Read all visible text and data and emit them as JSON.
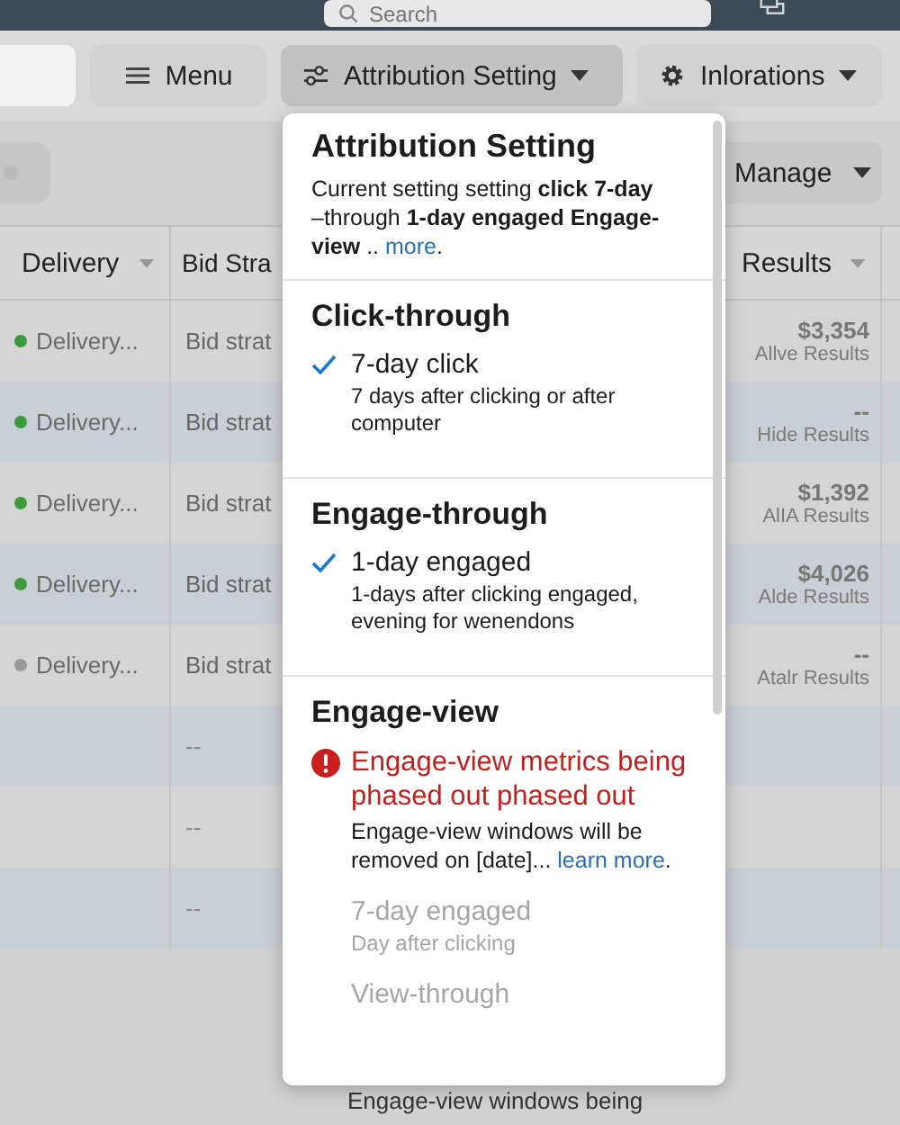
{
  "topbar": {
    "search": {
      "placeholder": "Search"
    }
  },
  "toolbar": {
    "buttons": [
      {
        "label": "Menu",
        "kind": "menu",
        "selected": false
      },
      {
        "label": "Attribution Setting",
        "kind": "filter",
        "selected": true
      },
      {
        "label": "Inlorations",
        "kind": "settings",
        "selected": false
      }
    ]
  },
  "toggle": {
    "on": false
  },
  "manage_button": "Manage",
  "table": {
    "columns": [
      "Delivery",
      "Bid Stra",
      "Results"
    ],
    "rows": [
      {
        "delivery": "Delivery...",
        "color": "#3d9b3d",
        "bid": "Bid strat",
        "result": "$3,354",
        "result_note": "Allve Results"
      },
      {
        "delivery": "Delivery...",
        "color": "#3d9b3d",
        "bid": "Bid strat",
        "result": "--",
        "result_note": "Hide Results"
      },
      {
        "delivery": "Delivery...",
        "color": "#3d9b3d",
        "bid": "Bid strat",
        "result": "$1,392",
        "result_note": "AlIA Results"
      },
      {
        "delivery": "Delivery...",
        "color": "#3d9b3d",
        "bid": "Bid strat",
        "result": "$4,026",
        "result_note": "Alde Results"
      },
      {
        "delivery": "Delivery...",
        "color": "#9a9a9a",
        "bid": "Bid strat",
        "result": "--",
        "result_note": "Atalr Results"
      },
      {
        "bid": "--"
      },
      {
        "bid": "--"
      },
      {
        "bid": "--"
      }
    ],
    "note": "Engage-view windows being"
  },
  "popover": {
    "title": "Attribution Setting",
    "summary": "Current setting setting **click** **7-day** –through **1-day engaged** **Engage-view** .. ",
    "summary_link": "more",
    "summary_end": ".",
    "sections": [
      {
        "title": "Click-through",
        "options": [
          {
            "label": "7-day click",
            "description": "7 days after clicking or after computer",
            "checked": true,
            "disabled": false
          }
        ]
      },
      {
        "title": "Engage-through",
        "options": [
          {
            "label": "1-day engaged",
            "description": "1-days after clicking engaged, evening for wenendons",
            "checked": true,
            "disabled": false
          }
        ]
      },
      {
        "title": "Engage-view",
        "warning": {
          "title": "Engage-view metrics being phased out phased out",
          "text": "Engage-view windows will be removed on [date]... ",
          "link": "learn more",
          "end": "."
        },
        "options": [
          {
            "label": "7-day engaged",
            "description": "Day after clicking",
            "checked": false,
            "disabled": true
          },
          {
            "label": "View-through",
            "checked": false,
            "disabled": true
          }
        ]
      }
    ]
  }
}
